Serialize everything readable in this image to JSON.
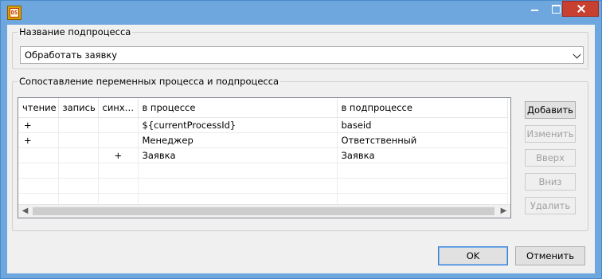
{
  "app_icon": "app-logo-icon",
  "title_bar": {
    "app_icon_text": "DS",
    "minimize_icon": "minimize-icon",
    "maximize_icon": "maximize-icon",
    "close_icon": "close-icon"
  },
  "subprocess_group": {
    "legend": "Название подпроцесса",
    "combo_value": "Обработать заявку"
  },
  "mapping_group": {
    "legend": "Сопоставление переменных процесса и подпроцесса",
    "columns": [
      "чтение",
      "запись",
      "синх…",
      "в процессе",
      "в подпроцессе"
    ],
    "rows": [
      {
        "read": "+",
        "write": "",
        "sync": "",
        "process_var": "${currentProcessId}",
        "subprocess_var": "baseid"
      },
      {
        "read": "+",
        "write": "",
        "sync": "",
        "process_var": "Менеджер",
        "subprocess_var": "Ответственный"
      },
      {
        "read": "",
        "write": "",
        "sync": "+",
        "process_var": "Заявка",
        "subprocess_var": "Заявка"
      },
      {
        "read": "",
        "write": "",
        "sync": "",
        "process_var": "",
        "subprocess_var": ""
      },
      {
        "read": "",
        "write": "",
        "sync": "",
        "process_var": "",
        "subprocess_var": ""
      },
      {
        "read": "",
        "write": "",
        "sync": "",
        "process_var": "",
        "subprocess_var": ""
      }
    ],
    "buttons": {
      "add": "Добавить",
      "edit": "Изменить",
      "up": "Вверх",
      "down": "Вниз",
      "delete": "Удалить"
    }
  },
  "footer": {
    "ok": "OK",
    "cancel": "Отменить"
  }
}
